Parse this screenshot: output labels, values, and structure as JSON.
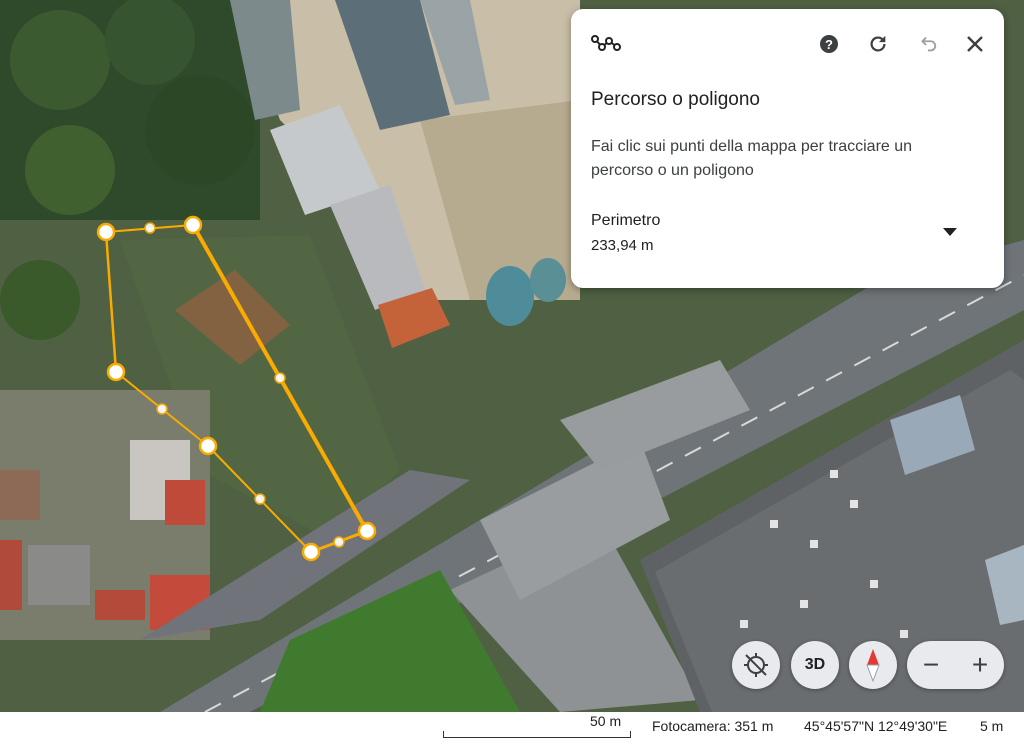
{
  "panel": {
    "title": "Percorso o poligono",
    "description": "Fai clic sui punti della mappa per tracciare un percorso o un poligono",
    "perimeter_label": "Perimetro",
    "perimeter_value": "233,94 m",
    "tool_icon": "path-measure-icon",
    "help_icon": "help-icon",
    "refresh_icon": "refresh-icon",
    "undo_icon": "undo-icon",
    "close_icon": "close-icon",
    "dropdown_icon": "caret-down-icon"
  },
  "controls": {
    "reset_tilt_icon": "reset-tilt-icon",
    "button_3d": "3D",
    "compass_icon": "compass-icon",
    "zoom_out": "−",
    "zoom_in": "+"
  },
  "status_bar": {
    "scale": "50 m",
    "camera": "Fotocamera: 351 m",
    "coordinates": "45°45'57\"N 12°49'30\"E",
    "elevation": "5 m"
  },
  "colors": {
    "path": "#f9ab00",
    "panel_bg": "#ffffff",
    "control_bg": "#e8eaed"
  }
}
